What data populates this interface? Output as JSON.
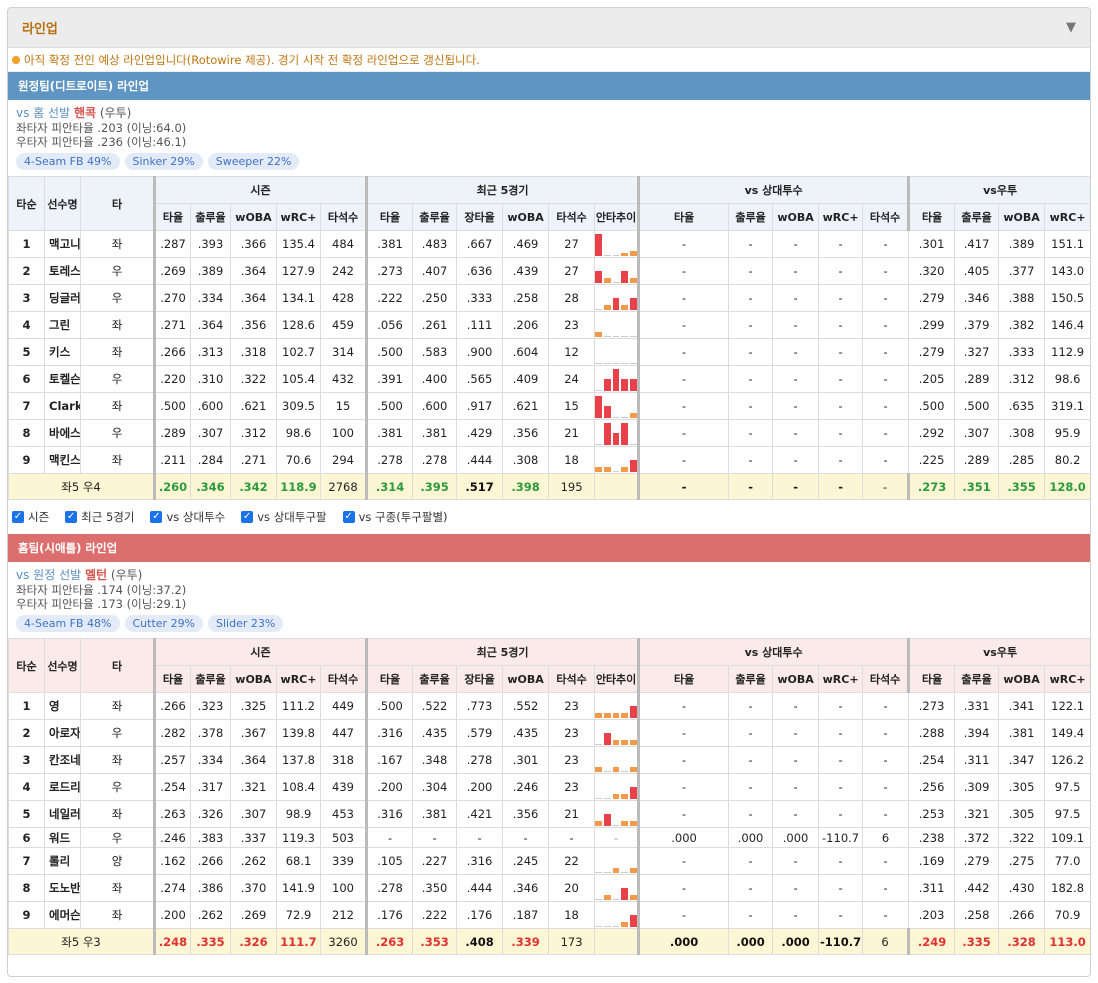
{
  "header": {
    "title": "라인업"
  },
  "notice": "아직 확정 전인 예상 라인업입니다(Rotowire 제공). 경기 시작 전 확정 라인업으로 갱신됩니다.",
  "columns": {
    "bat_order": "타순",
    "player": "선수명",
    "hand": "타",
    "groups": [
      "시즌",
      "최근 5경기",
      "vs 상대투수",
      "vs우투"
    ],
    "season": [
      "타율",
      "출루율",
      "wOBA",
      "wRC+",
      "타석수"
    ],
    "recent": [
      "타율",
      "출루율",
      "장타율",
      "wOBA",
      "타석수",
      "안타추이"
    ],
    "vs_pitcher": [
      "타율",
      "출루율",
      "wOBA",
      "wRC+",
      "타석수"
    ],
    "vs_hand": [
      "타율",
      "출루율",
      "wOBA",
      "wRC+"
    ]
  },
  "checks": [
    "시즌",
    "최근 5경기",
    "vs 상대투수",
    "vs 상대투구팔",
    "vs 구종(투구팔별)"
  ],
  "away": {
    "title": "원정팀(디트로이트) 라인업",
    "vs_prefix": "vs 홈 선발",
    "pitcher": "핸콕",
    "pitcher_hand": "(우투)",
    "line1": "좌타자 피안타율 .203 (이닝:64.0)",
    "line2": "우타자 피안타율 .236 (이닝:46.1)",
    "pitches": [
      "4-Seam FB 49%",
      "Sinker 29%",
      "Sweeper 22%"
    ],
    "rows": [
      [
        "1",
        "맥고니글",
        "좌",
        ".287",
        ".393",
        ".366",
        "135.4",
        "484",
        ".381",
        ".483",
        ".667",
        ".469",
        "27",
        "-",
        "-",
        "-",
        "-",
        "-",
        ".301",
        ".417",
        ".389",
        "151.1"
      ],
      [
        "2",
        "토레스",
        "우",
        ".269",
        ".389",
        ".364",
        "127.9",
        "242",
        ".273",
        ".407",
        ".636",
        ".439",
        "27",
        "-",
        "-",
        "-",
        "-",
        "-",
        ".320",
        ".405",
        ".377",
        "143.0"
      ],
      [
        "3",
        "딩글러",
        "우",
        ".270",
        ".334",
        ".364",
        "134.1",
        "428",
        ".222",
        ".250",
        ".333",
        ".258",
        "28",
        "-",
        "-",
        "-",
        "-",
        "-",
        ".279",
        ".346",
        ".388",
        "150.5"
      ],
      [
        "4",
        "그린",
        "좌",
        ".271",
        ".364",
        ".356",
        "128.6",
        "459",
        ".056",
        ".261",
        ".111",
        ".206",
        "23",
        "-",
        "-",
        "-",
        "-",
        "-",
        ".299",
        ".379",
        ".382",
        "146.4"
      ],
      [
        "5",
        "키스",
        "좌",
        ".266",
        ".313",
        ".318",
        "102.7",
        "314",
        ".500",
        ".583",
        ".900",
        ".604",
        "12",
        "-",
        "-",
        "-",
        "-",
        "-",
        ".279",
        ".327",
        ".333",
        "112.9"
      ],
      [
        "6",
        "토켈슨",
        "우",
        ".220",
        ".310",
        ".322",
        "105.4",
        "432",
        ".391",
        ".400",
        ".565",
        ".409",
        "24",
        "-",
        "-",
        "-",
        "-",
        "-",
        ".205",
        ".289",
        ".312",
        "98.6"
      ],
      [
        "7",
        "Clark",
        "좌",
        ".500",
        ".600",
        ".621",
        "309.5",
        "15",
        ".500",
        ".600",
        ".917",
        ".621",
        "15",
        "-",
        "-",
        "-",
        "-",
        "-",
        ".500",
        ".500",
        ".635",
        "319.1"
      ],
      [
        "8",
        "바에스",
        "우",
        ".289",
        ".307",
        ".312",
        "98.6",
        "100",
        ".381",
        ".381",
        ".429",
        ".356",
        "21",
        "-",
        "-",
        "-",
        "-",
        "-",
        ".292",
        ".307",
        ".308",
        "95.9"
      ],
      [
        "9",
        "맥킨스트리",
        "좌",
        ".211",
        ".284",
        ".271",
        "70.6",
        "294",
        ".278",
        ".278",
        ".444",
        ".308",
        "18",
        "-",
        "-",
        "-",
        "-",
        "-",
        ".225",
        ".289",
        ".285",
        "80.2"
      ]
    ],
    "spark": [
      [
        3,
        0,
        0,
        0.4,
        1
      ],
      [
        2,
        1,
        0,
        2,
        1
      ],
      [
        0,
        1,
        2,
        1,
        2
      ],
      [
        1,
        0,
        0,
        0,
        0
      ],
      [
        0,
        0,
        0,
        0,
        0
      ],
      [
        0,
        2,
        3,
        2,
        2
      ],
      [
        3,
        2,
        0,
        0,
        1
      ],
      [
        0,
        3,
        2,
        3,
        0
      ],
      [
        1,
        1,
        0,
        1,
        2
      ]
    ],
    "total": {
      "label": "좌5 우4",
      "vals": [
        ".260",
        ".346",
        ".342",
        "118.9",
        "2768",
        ".314",
        ".395",
        ".517",
        ".398",
        "195",
        "",
        "-",
        "-",
        "-",
        "-",
        "-",
        ".273",
        ".351",
        ".355",
        "128.0"
      ]
    }
  },
  "home": {
    "title": "홈팀(시애틀) 라인업",
    "vs_prefix": "vs 원정 선발",
    "pitcher": "멜턴",
    "pitcher_hand": "(우투)",
    "line1": "좌타자 피안타율 .174 (이닝:37.2)",
    "line2": "우타자 피안타율 .173 (이닝:29.1)",
    "pitches": [
      "4-Seam FB 48%",
      "Cutter 29%",
      "Slider 23%"
    ],
    "rows": [
      [
        "1",
        "영",
        "좌",
        ".266",
        ".323",
        ".325",
        "111.2",
        "449",
        ".500",
        ".522",
        ".773",
        ".552",
        "23",
        "-",
        "-",
        "-",
        "-",
        "-",
        ".273",
        ".331",
        ".341",
        "122.1"
      ],
      [
        "2",
        "아로자레나",
        "우",
        ".282",
        ".378",
        ".367",
        "139.8",
        "447",
        ".316",
        ".435",
        ".579",
        ".435",
        "23",
        "-",
        "-",
        "-",
        "-",
        "-",
        ".288",
        ".394",
        ".381",
        "149.4"
      ],
      [
        "3",
        "칸조네",
        "좌",
        ".257",
        ".334",
        ".364",
        "137.8",
        "318",
        ".167",
        ".348",
        ".278",
        ".301",
        "23",
        "-",
        "-",
        "-",
        "-",
        "-",
        ".254",
        ".311",
        ".347",
        "126.2"
      ],
      [
        "4",
        "로드리게스",
        "우",
        ".254",
        ".317",
        ".321",
        "108.4",
        "439",
        ".200",
        ".304",
        ".200",
        ".246",
        "23",
        "-",
        "-",
        "-",
        "-",
        "-",
        ".256",
        ".309",
        ".305",
        "97.5"
      ],
      [
        "5",
        "네일러",
        "좌",
        ".263",
        ".326",
        ".307",
        "98.9",
        "453",
        ".316",
        ".381",
        ".421",
        ".356",
        "21",
        "-",
        "-",
        "-",
        "-",
        "-",
        ".253",
        ".321",
        ".305",
        "97.5"
      ],
      [
        "6",
        "워드",
        "우",
        ".246",
        ".383",
        ".337",
        "119.3",
        "503",
        "-",
        "-",
        "-",
        "-",
        "-",
        ".000",
        ".000",
        ".000",
        "-110.7",
        "6",
        ".238",
        ".372",
        ".322",
        "109.1"
      ],
      [
        "7",
        "롤리",
        "양",
        ".162",
        ".266",
        ".262",
        "68.1",
        "339",
        ".105",
        ".227",
        ".316",
        ".245",
        "22",
        "-",
        "-",
        "-",
        "-",
        "-",
        ".169",
        ".279",
        ".275",
        "77.0"
      ],
      [
        "8",
        "도노반",
        "좌",
        ".274",
        ".386",
        ".370",
        "141.9",
        "100",
        ".278",
        ".350",
        ".444",
        ".346",
        "20",
        "-",
        "-",
        "-",
        "-",
        "-",
        ".311",
        ".442",
        ".430",
        "182.8"
      ],
      [
        "9",
        "에머슨",
        "좌",
        ".200",
        ".262",
        ".269",
        "72.9",
        "212",
        ".176",
        ".222",
        ".176",
        ".187",
        "18",
        "-",
        "-",
        "-",
        "-",
        "-",
        ".203",
        ".258",
        ".266",
        "70.9"
      ]
    ],
    "spark": [
      [
        1,
        1,
        1,
        1,
        2
      ],
      [
        0,
        2,
        1,
        1,
        1
      ],
      [
        1,
        0,
        1,
        0,
        1
      ],
      [
        0,
        0,
        1,
        1,
        2
      ],
      [
        1,
        2,
        0,
        1,
        1
      ],
      [
        0,
        0,
        0,
        0,
        0
      ],
      [
        0,
        0,
        1,
        0,
        1
      ],
      [
        0,
        1,
        0,
        2,
        1
      ],
      [
        0,
        0,
        0,
        1,
        2
      ]
    ],
    "total": {
      "label": "좌5 우3",
      "vals": [
        ".248",
        ".335",
        ".326",
        "111.7",
        "3260",
        ".263",
        ".353",
        ".408",
        ".339",
        "173",
        "",
        ".000",
        ".000",
        ".000",
        "-110.7",
        "6",
        ".249",
        ".335",
        ".328",
        "113.0"
      ]
    }
  },
  "colors": {
    "hit": "#e8414a",
    "single": "#f29a4a"
  }
}
